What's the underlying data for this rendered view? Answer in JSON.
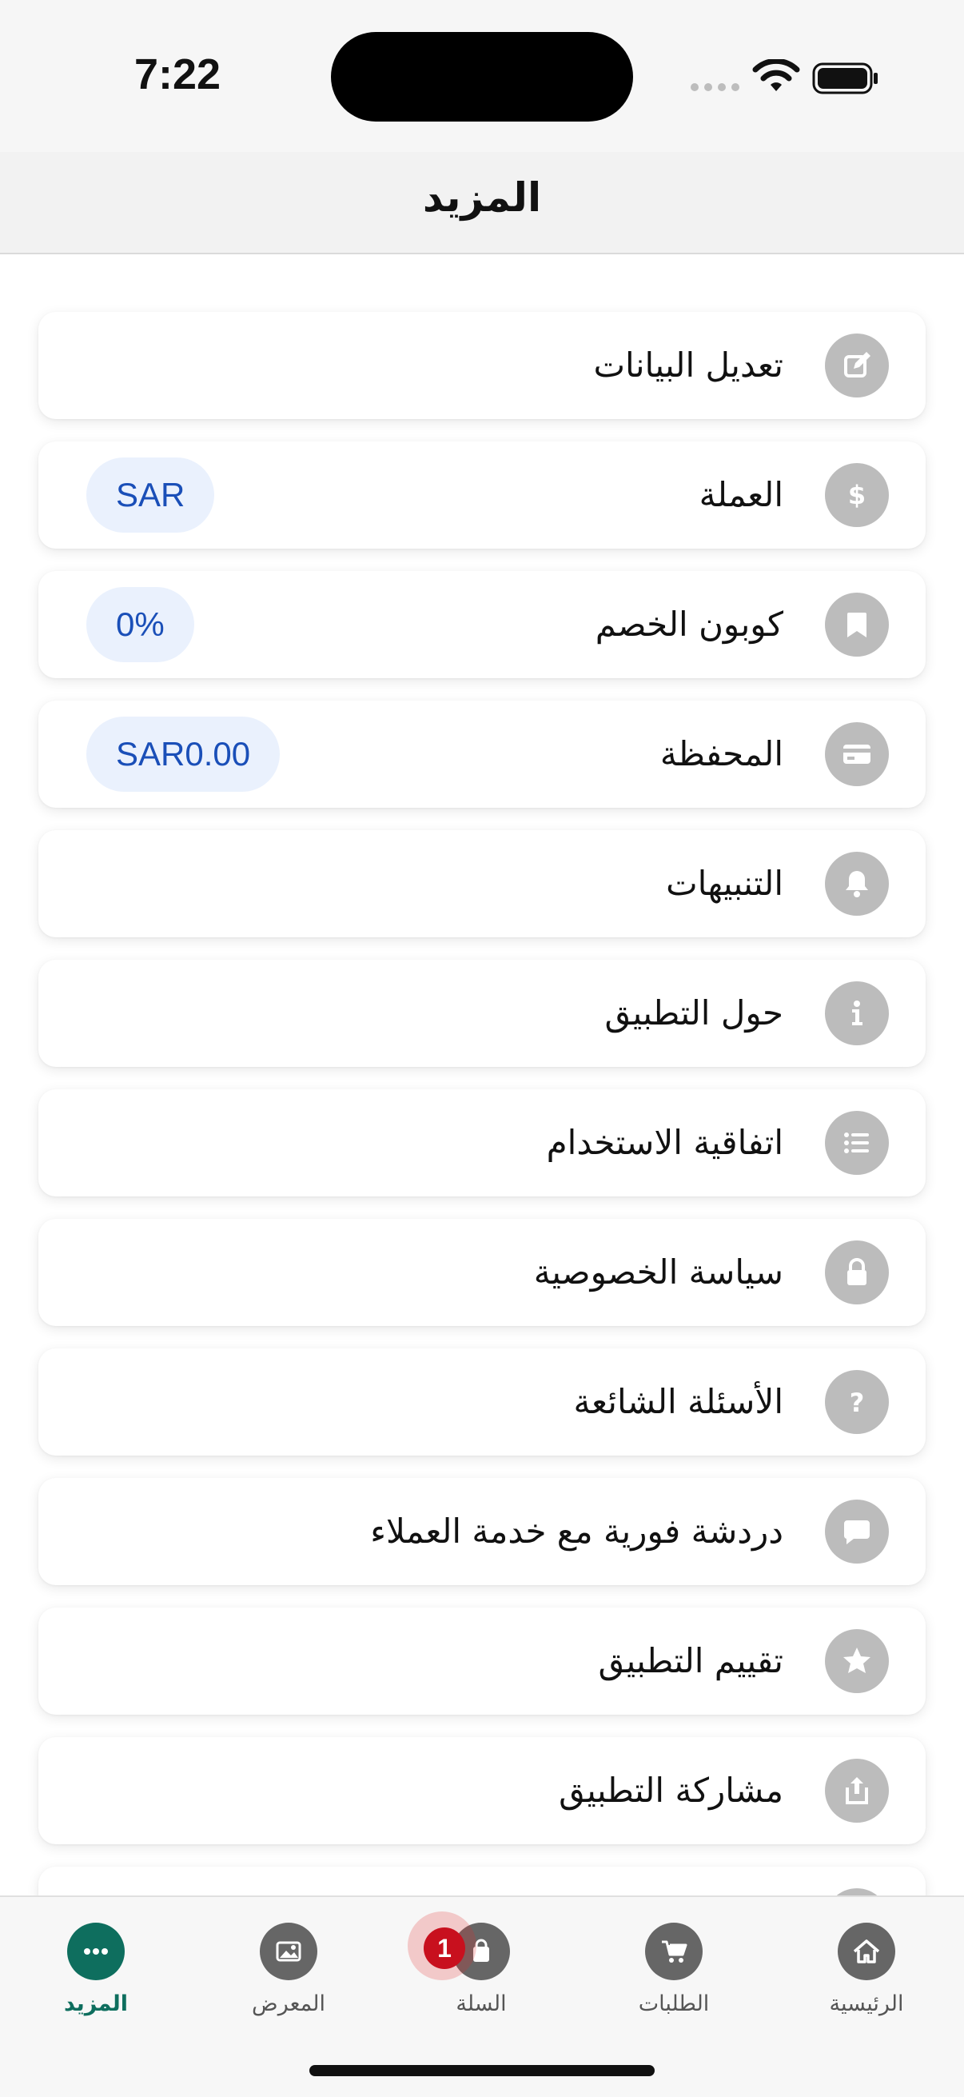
{
  "status_bar": {
    "time": "7:22"
  },
  "header": {
    "title": "المزيد"
  },
  "menu": [
    {
      "key": "edit-profile",
      "label": "تعديل البيانات",
      "icon": "edit-icon"
    },
    {
      "key": "currency",
      "label": "العملة",
      "icon": "dollar-icon",
      "value": "SAR"
    },
    {
      "key": "discount-coupon",
      "label": "كوبون الخصم",
      "icon": "bookmark-icon",
      "value": "0%"
    },
    {
      "key": "wallet",
      "label": "المحفظة",
      "icon": "card-icon",
      "value": "SAR0.00"
    },
    {
      "key": "notifications",
      "label": "التنبيهات",
      "icon": "bell-icon"
    },
    {
      "key": "about-app",
      "label": "حول التطبيق",
      "icon": "info-icon"
    },
    {
      "key": "terms",
      "label": "اتفاقية الاستخدام",
      "icon": "list-icon"
    },
    {
      "key": "privacy",
      "label": "سياسة الخصوصية",
      "icon": "lock-icon"
    },
    {
      "key": "faq",
      "label": "الأسئلة الشائعة",
      "icon": "question-icon"
    },
    {
      "key": "live-chat",
      "label": "دردشة فورية مع خدمة العملاء",
      "icon": "chat-icon"
    },
    {
      "key": "rate-app",
      "label": "تقييم التطبيق",
      "icon": "star-icon"
    },
    {
      "key": "share-app",
      "label": "مشاركة التطبيق",
      "icon": "share-icon"
    }
  ],
  "tab_bar": {
    "active": "more",
    "cart_badge": "1",
    "tabs": [
      {
        "key": "more",
        "label": "المزيد",
        "icon": "more-dots-icon"
      },
      {
        "key": "gallery",
        "label": "المعرض",
        "icon": "image-icon"
      },
      {
        "key": "cart",
        "label": "السلة",
        "icon": "bag-icon"
      },
      {
        "key": "orders",
        "label": "الطلبات",
        "icon": "cart-icon"
      },
      {
        "key": "home",
        "label": "الرئيسية",
        "icon": "home-icon"
      }
    ]
  },
  "colors": {
    "accent": "#0e6e5e",
    "pill_background": "#eaf1fd",
    "pill_text": "#1a4fb8",
    "icon_circle": "#bcbcbc",
    "badge": "#c8101e"
  }
}
